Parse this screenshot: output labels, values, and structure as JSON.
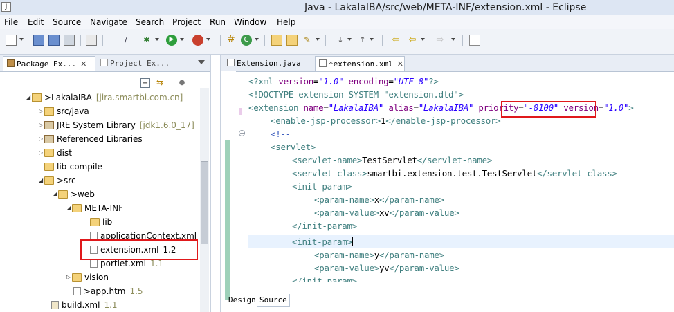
{
  "window": {
    "title": "Java - LakalaIBA/src/web/META-INF/extension.xml - Eclipse"
  },
  "menu": [
    "File",
    "Edit",
    "Source",
    "Navigate",
    "Search",
    "Project",
    "Run",
    "Window",
    "Help"
  ],
  "left_tabs": [
    {
      "label": "Package Ex...",
      "active": true
    },
    {
      "label": "Project Ex...",
      "active": false
    }
  ],
  "tree": [
    {
      "name": ">LakalaIBA",
      "meta": "[jira.smartbi.com.cn]"
    },
    {
      "name": "src/java",
      "meta": ""
    },
    {
      "name": "JRE System Library",
      "meta": "[jdk1.6.0_17]"
    },
    {
      "name": "Referenced Libraries",
      "meta": ""
    },
    {
      "name": "dist",
      "meta": ""
    },
    {
      "name": "lib-compile",
      "meta": ""
    },
    {
      "name": ">src",
      "meta": ""
    },
    {
      "name": ">web",
      "meta": ""
    },
    {
      "name": "META-INF",
      "meta": ""
    },
    {
      "name": "lib",
      "meta": ""
    },
    {
      "name": "applicationContext.xml",
      "meta": ""
    },
    {
      "name": "extension.xml",
      "meta": "1.2"
    },
    {
      "name": "portlet.xml",
      "meta": "1.1"
    },
    {
      "name": "vision",
      "meta": ""
    },
    {
      "name": ">app.htm",
      "meta": "1.5"
    },
    {
      "name": "build.xml",
      "meta": "1.1"
    }
  ],
  "editor_tabs": [
    {
      "label": "Extension.java",
      "active": false
    },
    {
      "label": "*extension.xml",
      "active": true
    }
  ],
  "bottom_tabs": [
    {
      "label": "Design",
      "active": false
    },
    {
      "label": "Source",
      "active": true
    }
  ],
  "code": {
    "l1": {
      "t1": "<?xml ",
      "a1": "version",
      "t2": "=",
      "v1": "\"1.0\"",
      "a2": " encoding",
      "t3": "=",
      "v2": "\"UTF-8\"",
      "t4": "?>"
    },
    "l2": {
      "t1": "<!DOCTYPE extension SYSTEM \"extension.dtd\">"
    },
    "l3": {
      "t1": "<extension ",
      "a1": "name",
      "t2": "=",
      "v1": "\"LakalaIBA\"",
      "a2": " alias",
      "t3": "=",
      "v2": "\"LakalaIBA\"",
      "a3": " priority",
      "t4": "=",
      "v3": "\"-8100\"",
      "a4": " version",
      "t5": "=",
      "v4": "\"1.0\"",
      "t6": ">"
    },
    "l4": {
      "t1": "<enable-jsp-processor>",
      "x1": "1",
      "t2": "</enable-jsp-processor>"
    },
    "l5": {
      "c1": "<!--"
    },
    "l6": {
      "t1": "<servlet>"
    },
    "l7": {
      "t1": "<servlet-name>",
      "x1": "TestServlet",
      "t2": "</servlet-name>"
    },
    "l8": {
      "t1": "<servlet-class>",
      "x1": "smartbi.extension.test.TestServlet",
      "t2": "</servlet-class>"
    },
    "l9": {
      "t1": "<init-param>"
    },
    "l10": {
      "t1": "<param-name>",
      "x1": "x",
      "t2": "</param-name>"
    },
    "l11": {
      "t1": "<param-value>",
      "x1": "xv",
      "t2": "</param-value>"
    },
    "l12": {
      "t1": "</init-param>"
    },
    "l13": {
      "t1": "<init-param>"
    },
    "l14": {
      "t1": "<param-name>",
      "x1": "y",
      "t2": "</param-name>"
    },
    "l15": {
      "t1": "<param-value>",
      "x1": "yv",
      "t2": "</param-value>"
    },
    "l16": {
      "t1": "</init-param>"
    }
  },
  "colors": {
    "tag": "#3f7f7f",
    "attribute": "#7f007f",
    "value": "#2a00ff",
    "comment": "#3f5fbf",
    "highlight_box": "#e0191b"
  }
}
